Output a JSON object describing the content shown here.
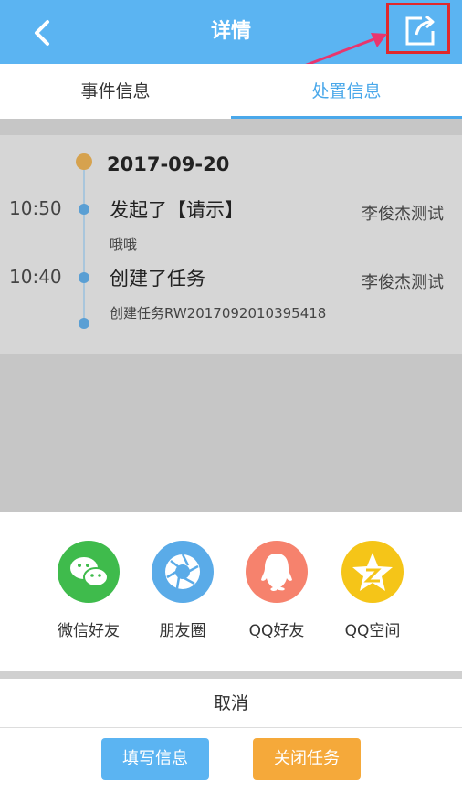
{
  "header": {
    "title": "详情",
    "back_icon": "chevron-left-icon",
    "share_icon": "share-export-icon"
  },
  "tabs": [
    {
      "label": "事件信息",
      "active": false
    },
    {
      "label": "处置信息",
      "active": true
    }
  ],
  "timeline": {
    "date": "2017-09-20",
    "entries": [
      {
        "time": "10:50",
        "action": "发起了【请示】",
        "user": "李俊杰测试",
        "desc": "哦哦"
      },
      {
        "time": "10:40",
        "action": "创建了任务",
        "user": "李俊杰测试",
        "desc": "创建任务RW2017092010395418"
      }
    ]
  },
  "share_sheet": {
    "items": [
      {
        "label": "微信好友",
        "icon": "wechat-icon",
        "color": "#3fbb4c"
      },
      {
        "label": "朋友圈",
        "icon": "moments-icon",
        "color": "#5aabe8"
      },
      {
        "label": "QQ好友",
        "icon": "qq-icon",
        "color": "#f6826d"
      },
      {
        "label": "QQ空间",
        "icon": "qzone-icon",
        "color": "#f5c518"
      }
    ],
    "cancel_label": "取消"
  },
  "actions": {
    "fill_info_label": "填写信息",
    "close_task_label": "关闭任务"
  },
  "colors": {
    "header": "#5bb4f2",
    "accent": "#4aa8ea",
    "date_dot": "#d6a24e",
    "close_btn": "#f5a93a"
  }
}
